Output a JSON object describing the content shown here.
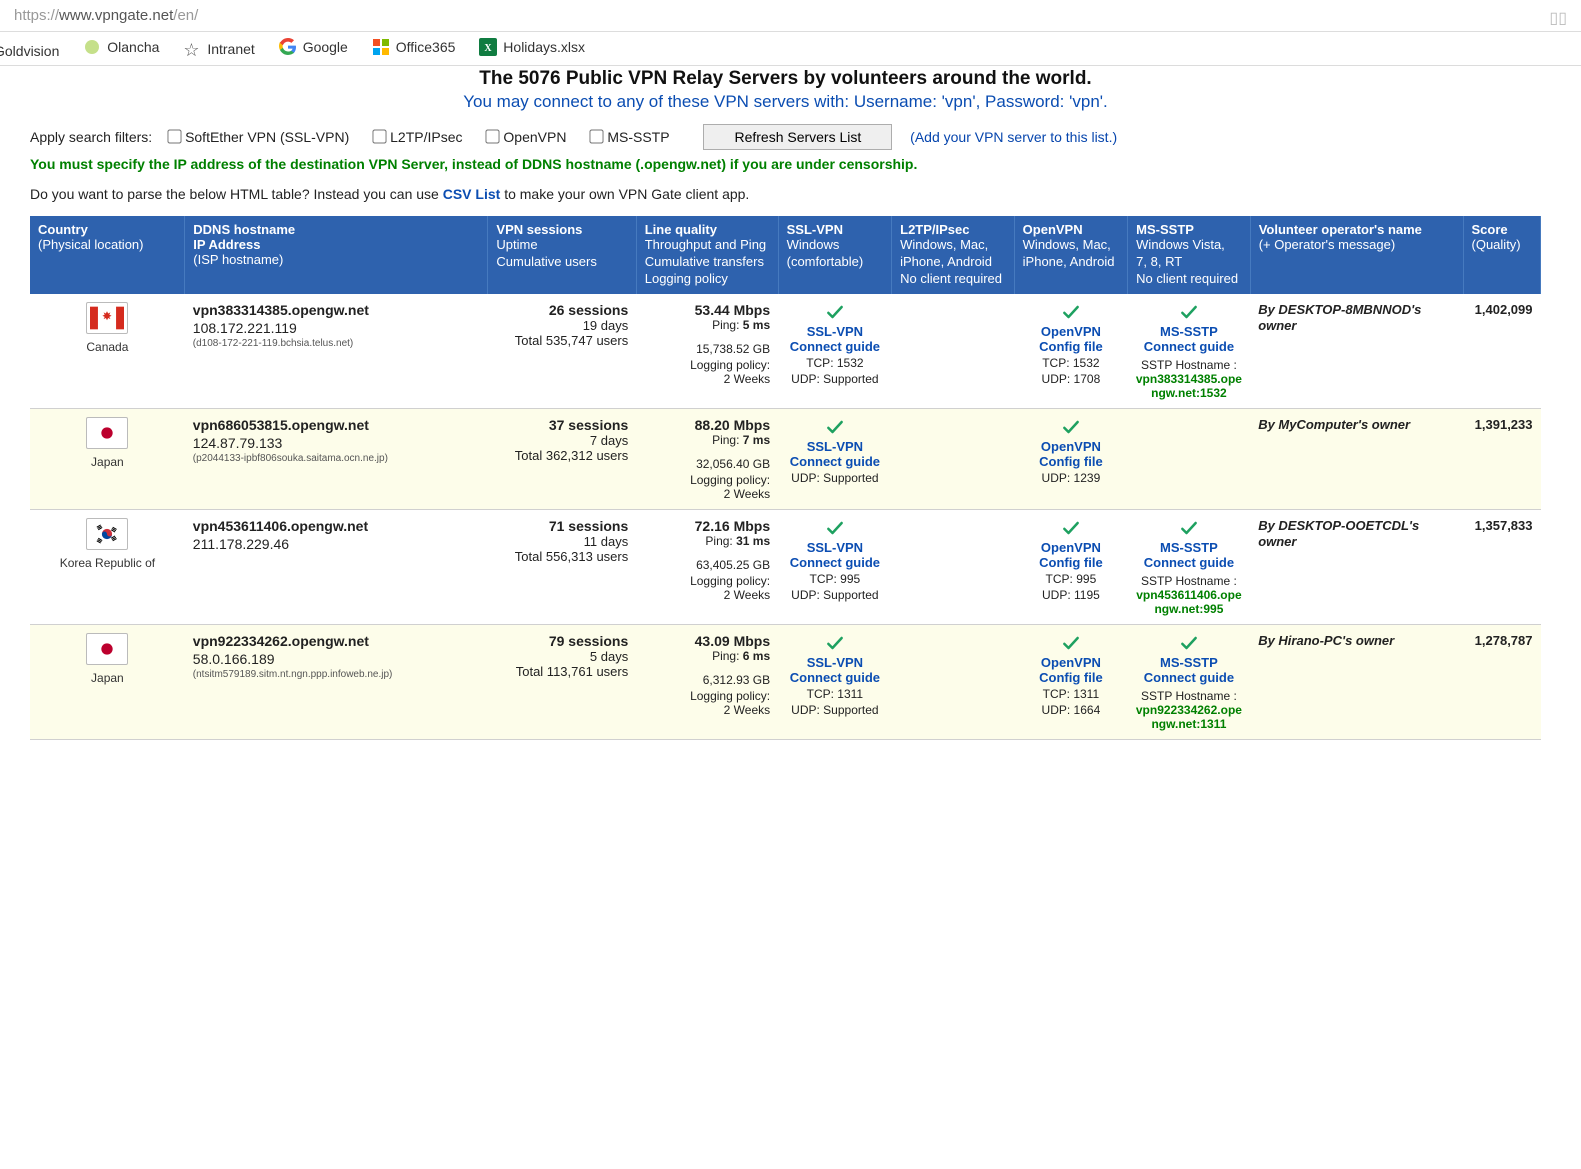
{
  "browser": {
    "url_prefix": "https://",
    "url_host": "www.vpngate.net",
    "url_path": "/en/"
  },
  "bookmarks": {
    "goldvision": "Goldvision",
    "olancha": "Olancha",
    "intranet": "Intranet",
    "google": "Google",
    "office365": "Office365",
    "holidays": "Holidays.xlsx"
  },
  "page": {
    "title": "The 5076 Public VPN Relay Servers by volunteers around the world.",
    "subtitle": "You may connect to any of these VPN servers with: Username: 'vpn', Password: 'vpn'.",
    "filter_label": "Apply search filters:",
    "filter_softether": "SoftEther VPN (SSL-VPN)",
    "filter_l2tp": "L2TP/IPsec",
    "filter_openvpn": "OpenVPN",
    "filter_mssstp": "MS-SSTP",
    "refresh_button": "Refresh Servers List",
    "add_server_link": "(Add your VPN server to this list.)",
    "censorship_note": "You must specify the IP address of the destination VPN Server, instead of DDNS hostname (.opengw.net) if you are under censorship.",
    "parse_pre": "Do you want to parse the below HTML table? Instead you can use ",
    "parse_link": "CSV List",
    "parse_post": " to make your own VPN Gate client app."
  },
  "headers": {
    "country_h1": "Country",
    "country_h2": "(Physical location)",
    "ddns_h1": "DDNS hostname",
    "ddns_h2": "IP Address",
    "ddns_h3": "(ISP hostname)",
    "sess_h1": "VPN sessions",
    "sess_h2": "Uptime",
    "sess_h3": "Cumulative users",
    "qual_h1": "Line quality",
    "qual_h2": "Throughput and Ping",
    "qual_h3": "Cumulative transfers",
    "qual_h4": "Logging policy",
    "ssl_h1": "SSL-VPN",
    "ssl_h2": "Windows",
    "ssl_h3": "(comfortable)",
    "l2tp_h1": "L2TP/IPsec",
    "l2tp_h2": "Windows, Mac,",
    "l2tp_h3": "iPhone, Android",
    "l2tp_h4": "No client required",
    "ovpn_h1": "OpenVPN",
    "ovpn_h2": "Windows, Mac,",
    "ovpn_h3": "iPhone, Android",
    "sstp_h1": "MS-SSTP",
    "sstp_h2": "Windows Vista,",
    "sstp_h3": "7, 8, RT",
    "sstp_h4": "No client required",
    "owner_h1": "Volunteer operator's name",
    "owner_h2": "(+ Operator's message)",
    "score_h1": "Score",
    "score_h2": "(Quality)"
  },
  "labels": {
    "ssl_vpn": "SSL-VPN",
    "connect_guide": "Connect guide",
    "openvpn": "OpenVPN",
    "config_file": "Config file",
    "mssstp": "MS-SSTP",
    "sstp_hostname": "SSTP Hostname :",
    "logging_policy": "Logging policy:",
    "two_weeks": "2 Weeks"
  },
  "rows": [
    {
      "flag": "canada",
      "country": "Canada",
      "ddns": "vpn383314385.opengw.net",
      "ip": "108.172.221.119",
      "isp": "(d108-172-221-119.bchsia.telus.net)",
      "sessions": "26 sessions",
      "uptime": "19 days",
      "cum_users": "Total 535,747 users",
      "mbps": "53.44 Mbps",
      "ping": "5 ms",
      "transfers": "15,738.52 GB",
      "ssl_tcp": "TCP: 1532",
      "ssl_udp": "UDP: Supported",
      "ovpn_tcp": "TCP: 1532",
      "ovpn_udp": "UDP: 1708",
      "has_sstp": true,
      "sstp_host": "vpn383314385.opengw.net:1532",
      "owner": "By DESKTOP-8MBNNOD's owner",
      "score": "1,402,099"
    },
    {
      "flag": "japan",
      "country": "Japan",
      "ddns": "vpn686053815.opengw.net",
      "ip": "124.87.79.133",
      "isp": "(p2044133-ipbf806souka.saitama.ocn.ne.jp)",
      "sessions": "37 sessions",
      "uptime": "7 days",
      "cum_users": "Total 362,312 users",
      "mbps": "88.20 Mbps",
      "ping": "7 ms",
      "transfers": "32,056.40 GB",
      "ssl_tcp": "",
      "ssl_udp": "UDP: Supported",
      "ovpn_tcp": "",
      "ovpn_udp": "UDP: 1239",
      "has_sstp": false,
      "sstp_host": "",
      "owner": "By MyComputer's owner",
      "score": "1,391,233"
    },
    {
      "flag": "korea",
      "country": "Korea Republic of",
      "ddns": "vpn453611406.opengw.net",
      "ip": "211.178.229.46",
      "isp": "",
      "sessions": "71 sessions",
      "uptime": "11 days",
      "cum_users": "Total 556,313 users",
      "mbps": "72.16 Mbps",
      "ping": "31 ms",
      "transfers": "63,405.25 GB",
      "ssl_tcp": "TCP: 995",
      "ssl_udp": "UDP: Supported",
      "ovpn_tcp": "TCP: 995",
      "ovpn_udp": "UDP: 1195",
      "has_sstp": true,
      "sstp_host": "vpn453611406.opengw.net:995",
      "owner": "By DESKTOP-OOETCDL's owner",
      "score": "1,357,833"
    },
    {
      "flag": "japan",
      "country": "Japan",
      "ddns": "vpn922334262.opengw.net",
      "ip": "58.0.166.189",
      "isp": "(ntsitm579189.sitm.nt.ngn.ppp.infoweb.ne.jp)",
      "sessions": "79 sessions",
      "uptime": "5 days",
      "cum_users": "Total 113,761 users",
      "mbps": "43.09 Mbps",
      "ping": "6 ms",
      "transfers": "6,312.93 GB",
      "ssl_tcp": "TCP: 1311",
      "ssl_udp": "UDP: Supported",
      "ovpn_tcp": "TCP: 1311",
      "ovpn_udp": "UDP: 1664",
      "has_sstp": true,
      "sstp_host": "vpn922334262.opengw.net:1311",
      "owner": "By Hirano-PC's owner",
      "score": "1,278,787"
    }
  ]
}
